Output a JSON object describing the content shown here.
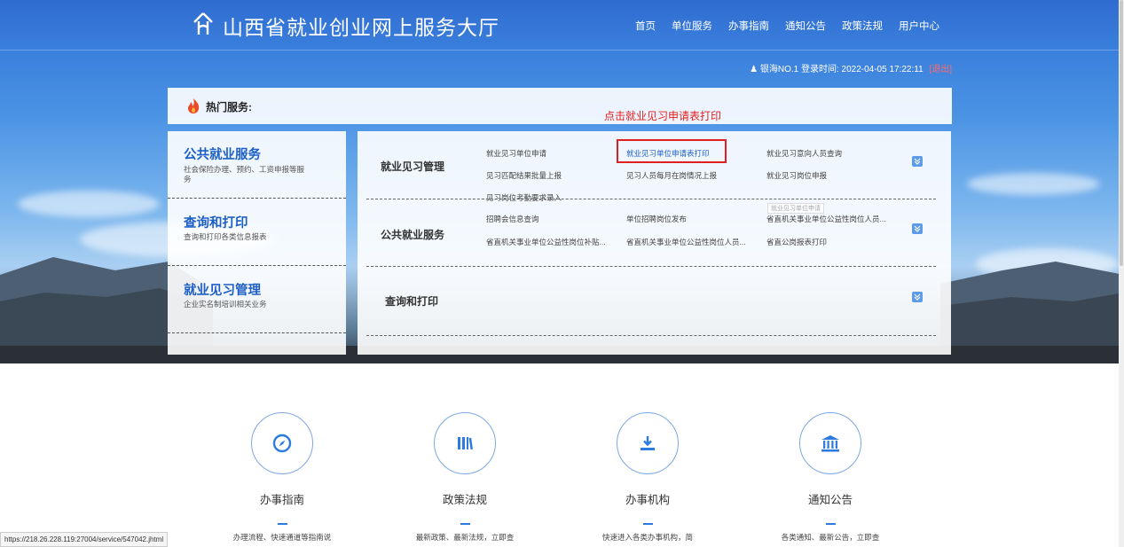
{
  "header": {
    "title": "山西省就业创业网上服务大厅",
    "nav": [
      "首页",
      "单位服务",
      "办事指南",
      "通知公告",
      "政策法规",
      "用户中心"
    ]
  },
  "login": {
    "user": "银海NO.1",
    "label": "登录时间:",
    "time": "2022-04-05 17:22:11",
    "logout": "[退出]"
  },
  "hot": {
    "title": "热门服务:",
    "annotation": "点击就业见习申请表打印"
  },
  "left_categories": [
    {
      "title": "公共就业服务",
      "desc": "社会保险办理、预约、工资申报等服务"
    },
    {
      "title": "查询和打印",
      "desc": "查询和打印各类信息报表"
    },
    {
      "title": "就业见习管理",
      "desc": "企业实名制培训相关业务"
    }
  ],
  "main_rows": [
    {
      "title": "就业见习管理",
      "links": [
        "就业见习单位申请",
        "就业见习单位申请表打印",
        "就业见习意向人员查询",
        "见习匹配结果批量上报",
        "见习人员每月在岗情况上报",
        "就业见习岗位申报",
        "见习岗位考勤要求录入"
      ]
    },
    {
      "title": "公共就业服务",
      "links": [
        "招聘会信息查询",
        "单位招聘岗位发布",
        "省直机关事业单位公益性岗位人员...",
        "省直机关事业单位公益性岗位补贴...",
        "省直机关事业单位公益性岗位人员...",
        "省直公岗报表打印"
      ]
    },
    {
      "title": "查询和打印",
      "links": []
    }
  ],
  "tooltip_ghost": "就业见习单位申请",
  "features": [
    {
      "title": "办事指南",
      "desc": "办理流程、快速通道等指南说",
      "icon": "compass-icon"
    },
    {
      "title": "政策法规",
      "desc": "最新政策、最新法规，立即查",
      "icon": "books-icon"
    },
    {
      "title": "办事机构",
      "desc": "快速进入各类办事机构，简",
      "icon": "download-icon"
    },
    {
      "title": "通知公告",
      "desc": "各类通知、最新公告，立即查",
      "icon": "bank-icon"
    }
  ],
  "status_url": "https://218.26.228.119:27004/service/547042.jhtml",
  "colors": {
    "accent": "#1d5fc6",
    "highlight": "#e02020"
  }
}
